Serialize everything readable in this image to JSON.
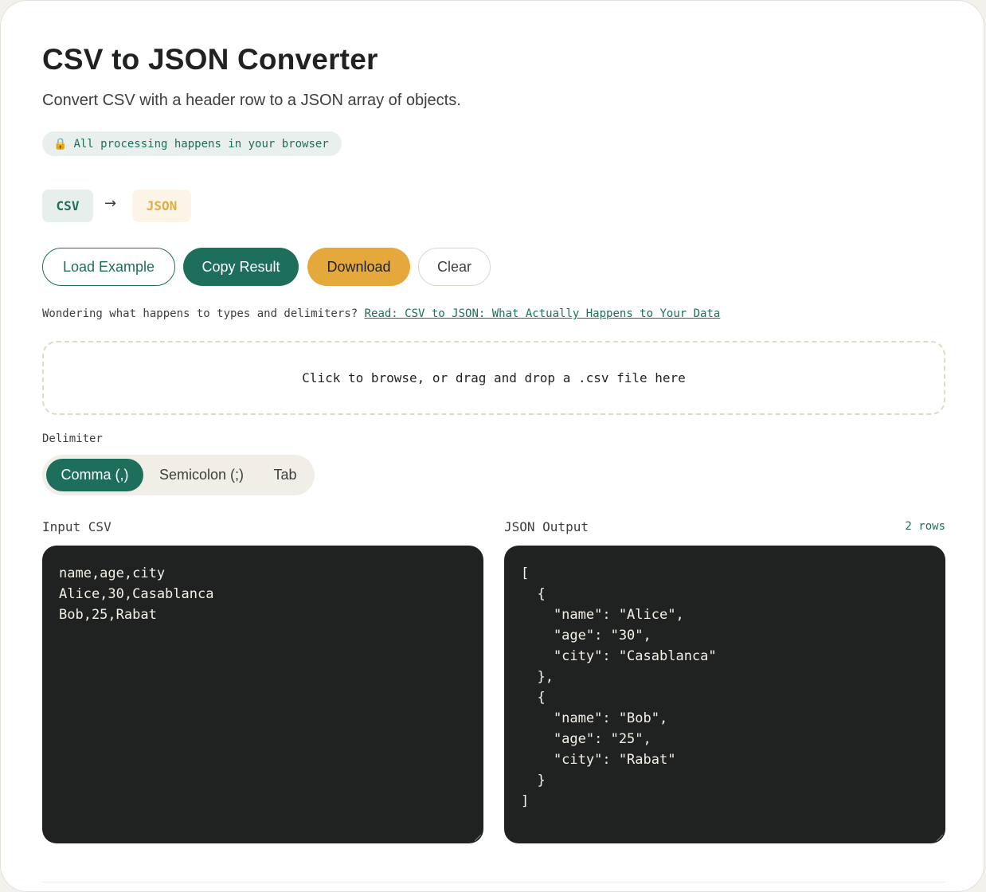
{
  "header": {
    "title": "CSV to JSON Converter",
    "subtitle": "Convert CSV with a header row to a JSON array of objects.",
    "privacy_badge": "All processing happens in your browser",
    "privacy_icon": "lock-icon"
  },
  "formats": {
    "from": "CSV",
    "arrow": "→",
    "to": "JSON"
  },
  "toolbar": {
    "load_example_label": "Load Example",
    "copy_result_label": "Copy Result",
    "download_label": "Download",
    "clear_label": "Clear"
  },
  "hint": {
    "text": "Wondering what happens to types and delimiters?",
    "link_text": "Read: CSV to JSON: What Actually Happens to Your Data"
  },
  "dropzone": {
    "text": "Click to browse, or drag and drop a .csv file here"
  },
  "delimiter": {
    "label": "Delimiter",
    "options": [
      {
        "label": "Comma (,)",
        "selected": true
      },
      {
        "label": "Semicolon (;)",
        "selected": false
      },
      {
        "label": "Tab",
        "selected": false
      }
    ]
  },
  "input_panel": {
    "label": "Input CSV",
    "value": "name,age,city\nAlice,30,Casablanca\nBob,25,Rabat"
  },
  "output_panel": {
    "label": "JSON Output",
    "row_count": "2 rows",
    "value": "[\n  {\n    \"name\": \"Alice\",\n    \"age\": \"30\",\n    \"city\": \"Casablanca\"\n  },\n  {\n    \"name\": \"Bob\",\n    \"age\": \"25\",\n    \"city\": \"Rabat\"\n  }\n]"
  },
  "colors": {
    "accent_green": "#1e6e5c",
    "accent_gold": "#e4a83b",
    "editor_bg": "#1f2220"
  }
}
